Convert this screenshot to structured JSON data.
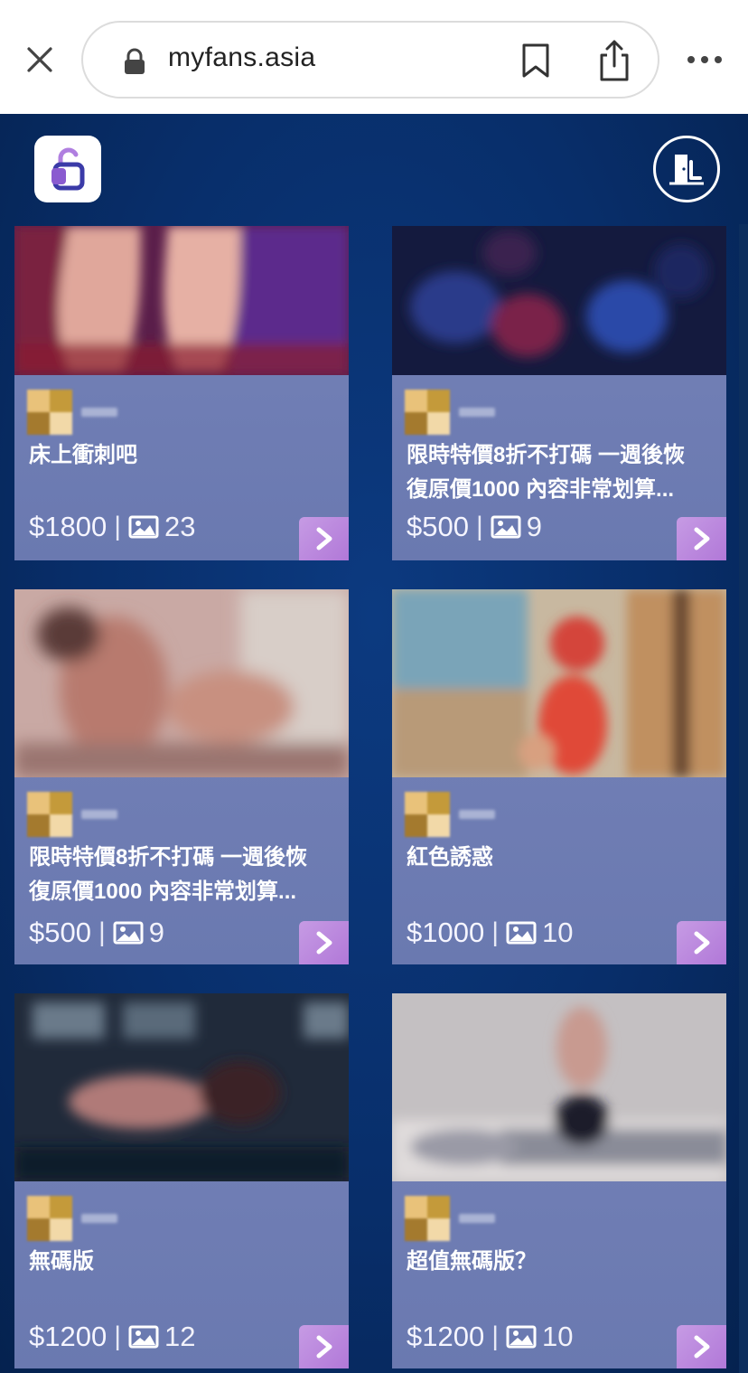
{
  "browser": {
    "url": "myfans.asia"
  },
  "app": {
    "brand_color": "#8a5bd0",
    "background_color": "#082e6a"
  },
  "cards": [
    {
      "title": "床上衝刺吧",
      "price": "$1800",
      "image_count": "23"
    },
    {
      "title": "限時特價8折不打碼 一週後恢\n復原價1000 內容非常划算...",
      "price": "$500",
      "image_count": "9"
    },
    {
      "title": "限時特價8折不打碼 一週後恢\n復原價1000 內容非常划算...",
      "price": "$500",
      "image_count": "9"
    },
    {
      "title": "紅色誘惑",
      "price": "$1000",
      "image_count": "10"
    },
    {
      "title": "無碼版",
      "price": "$1200",
      "image_count": "12"
    },
    {
      "title": "超值無碼版？",
      "price": "$1200",
      "image_count": "10"
    }
  ],
  "separator": "|"
}
